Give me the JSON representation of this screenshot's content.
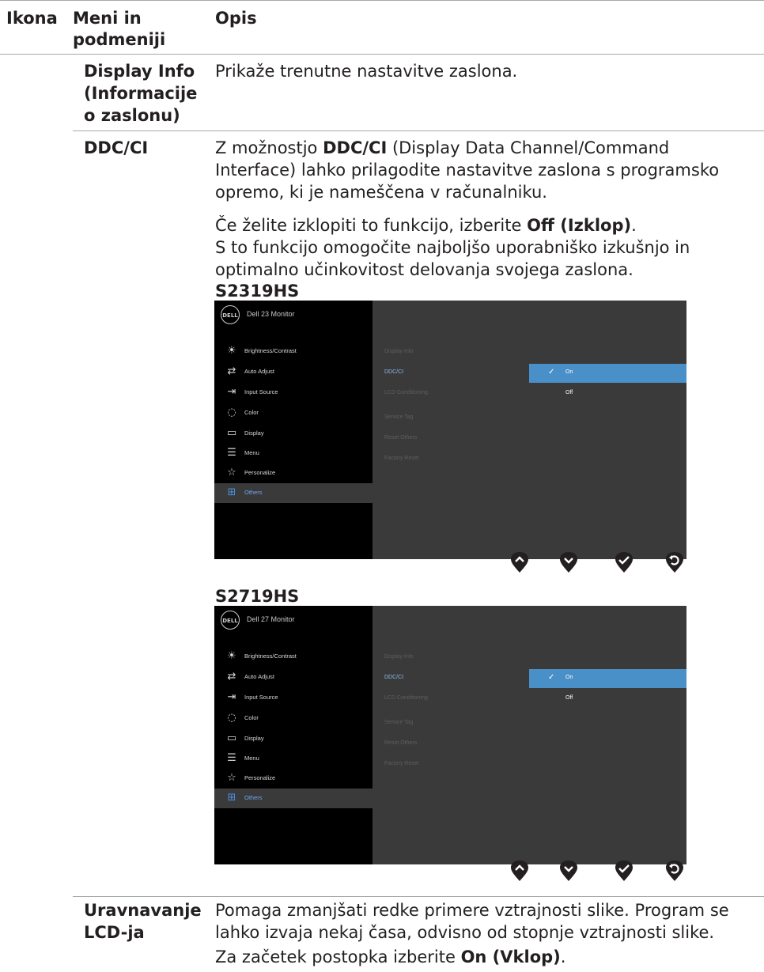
{
  "header": {
    "col_icon": "Ikona",
    "col_menu": "Meni in podmeniji",
    "col_desc": "Opis"
  },
  "rows": {
    "display_info": {
      "label": "Display Info (Informacije o zaslonu)",
      "desc": "Prikaže trenutne nastavitve zaslona."
    },
    "ddcci": {
      "label": "DDC/CI",
      "p1_pre": "Z možnostjo ",
      "p1_bold": "DDC/CI",
      "p1_post": " (Display Data Channel/Command Interface) lahko prilagodite nastavitve zaslona s programsko opremo, ki je nameščena v računalniku.",
      "p2_pre": "Če želite izklopiti to funkcijo, izberite ",
      "p2_bold": "Off (Izklop)",
      "p2_post": ".",
      "p3": "S to funkcijo omogočite najboljšo uporabniško izkušnjo in optimalno učinkovitost delovanja svojega zaslona."
    },
    "lcd": {
      "label": "Uravnavanje LCD-ja",
      "p1": "Pomaga zmanjšati redke primere vztrajnosti slike. Program se lahko izvaja nekaj časa, odvisno od stopnje vztrajnosti slike.",
      "p2_pre": "Za začetek postopka izberite ",
      "p2_bold": "On (Vklop)",
      "p2_post": "."
    }
  },
  "osd1": {
    "model": "S2319HS",
    "logo": "DELL",
    "title": "Dell 23 Monitor",
    "menu": [
      "Brightness/Contrast",
      "Auto Adjust",
      "Input Source",
      "Color",
      "Display",
      "Menu",
      "Personalize",
      "Others"
    ],
    "submenu": [
      "Display Info",
      "DDC/CI",
      "LCD Conditioning",
      "Service Tag",
      "Reset Others",
      "Factory Reset"
    ],
    "options": [
      "On",
      "Off"
    ]
  },
  "osd2": {
    "model": "S2719HS",
    "logo": "DELL",
    "title": "Dell 27 Monitor",
    "menu": [
      "Brightness/Contrast",
      "Auto Adjust",
      "Input Source",
      "Color",
      "Display",
      "Menu",
      "Personalize",
      "Others"
    ],
    "submenu": [
      "Display Info",
      "DDC/CI",
      "LCD Conditioning",
      "Service Tag",
      "Reset Others",
      "Factory Reset"
    ],
    "options": [
      "On",
      "Off"
    ]
  },
  "icons": {
    "menu": [
      "brightness-icon",
      "auto-adjust-icon",
      "input-source-icon",
      "color-icon",
      "display-icon",
      "menu-icon",
      "personalize-icon",
      "others-icon"
    ],
    "buttons": [
      "up-icon",
      "down-icon",
      "check-icon",
      "back-icon"
    ]
  },
  "colors": {
    "selection": "#4a90c8",
    "osd_bg": "#3a3a3a",
    "sidebar": "#000000"
  }
}
